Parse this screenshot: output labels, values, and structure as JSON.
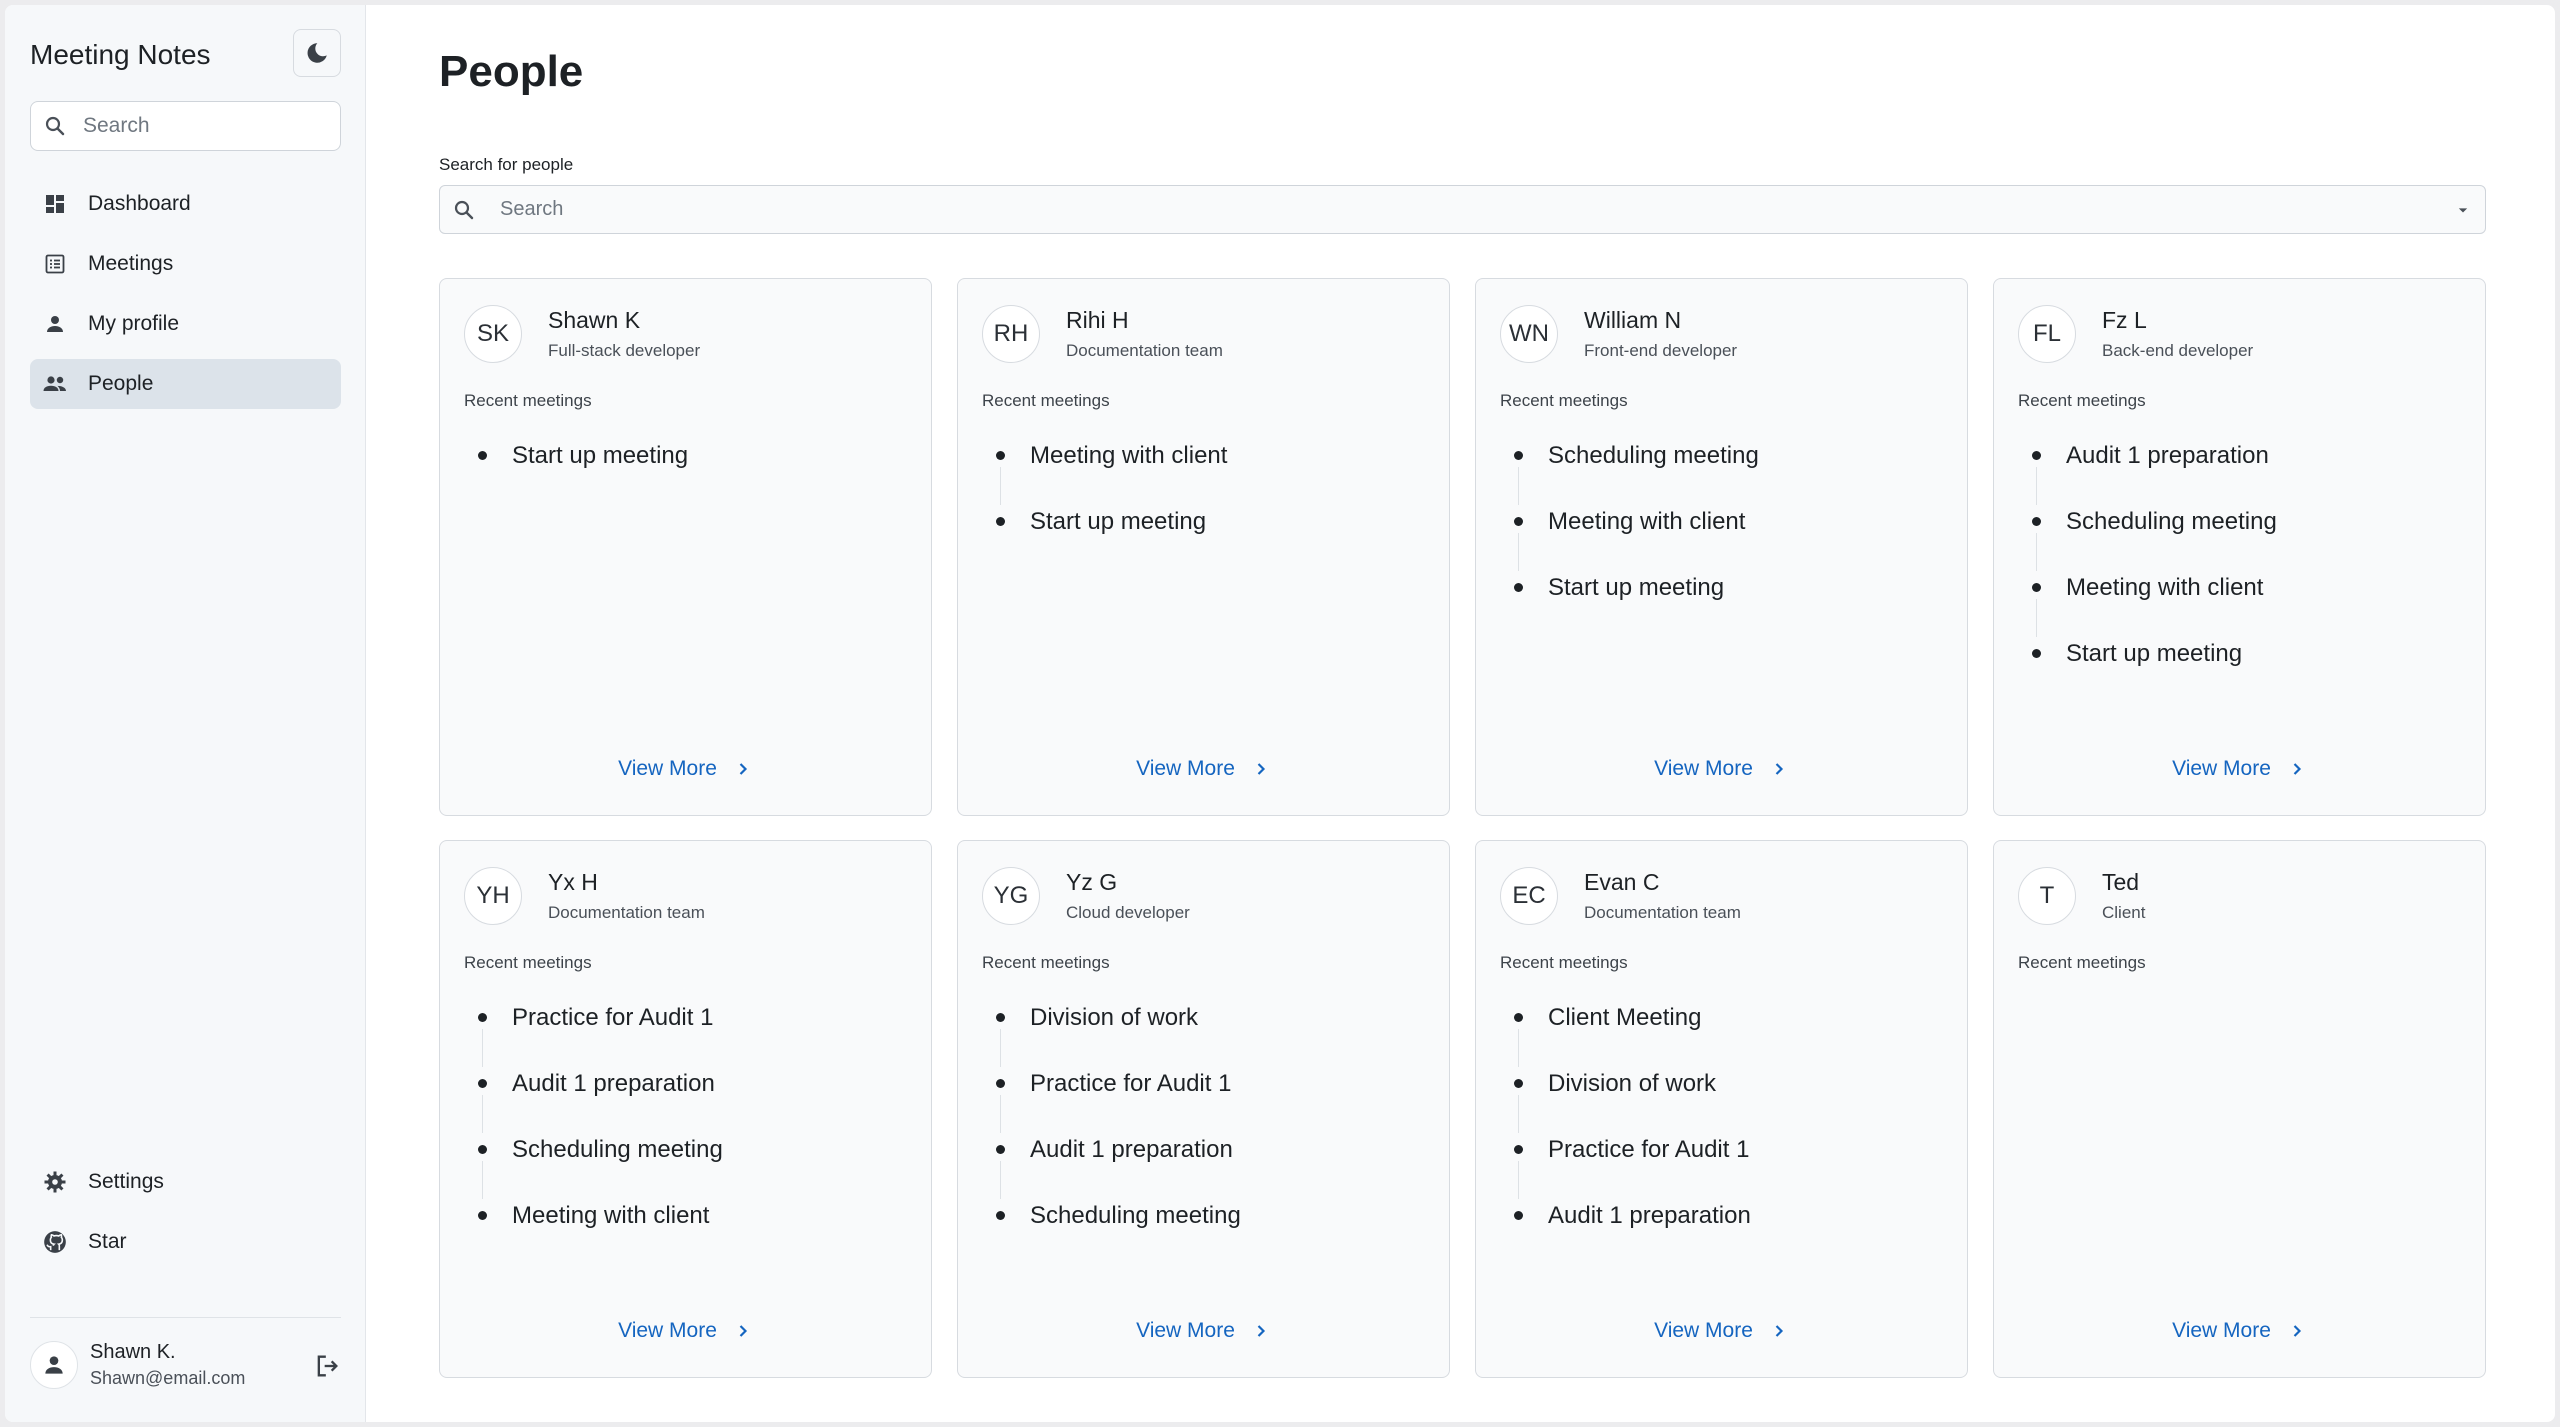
{
  "app": {
    "title": "Meeting Notes"
  },
  "sidebar": {
    "search_placeholder": "Search",
    "nav": [
      {
        "label": "Dashboard",
        "icon": "dashboard-icon",
        "active": false
      },
      {
        "label": "Meetings",
        "icon": "list-icon",
        "active": false
      },
      {
        "label": "My profile",
        "icon": "person-icon",
        "active": false
      },
      {
        "label": "People",
        "icon": "people-icon",
        "active": true
      }
    ],
    "bottom": [
      {
        "label": "Settings",
        "icon": "gear-icon"
      },
      {
        "label": "Star",
        "icon": "github-icon"
      }
    ],
    "user": {
      "name": "Shawn K.",
      "email": "Shawn@email.com"
    }
  },
  "main": {
    "title": "People",
    "search_label": "Search for people",
    "search_placeholder": "Search",
    "recent_label": "Recent meetings",
    "view_more_label": "View More",
    "people": [
      {
        "initials": "SK",
        "name": "Shawn K",
        "role": "Full-stack developer",
        "meetings": [
          "Start up meeting"
        ]
      },
      {
        "initials": "RH",
        "name": "Rihi H",
        "role": "Documentation team",
        "meetings": [
          "Meeting with client",
          "Start up meeting"
        ]
      },
      {
        "initials": "WN",
        "name": "William N",
        "role": "Front-end developer",
        "meetings": [
          "Scheduling meeting",
          "Meeting with client",
          "Start up meeting"
        ]
      },
      {
        "initials": "FL",
        "name": "Fz L",
        "role": "Back-end developer",
        "meetings": [
          "Audit 1 preparation",
          "Scheduling meeting",
          "Meeting with client",
          "Start up meeting"
        ]
      },
      {
        "initials": "YH",
        "name": "Yx H",
        "role": "Documentation team",
        "meetings": [
          "Practice for Audit 1",
          "Audit 1 preparation",
          "Scheduling meeting",
          "Meeting with client"
        ]
      },
      {
        "initials": "YG",
        "name": "Yz G",
        "role": "Cloud developer",
        "meetings": [
          "Division of work",
          "Practice for Audit 1",
          "Audit 1 preparation",
          "Scheduling meeting"
        ]
      },
      {
        "initials": "EC",
        "name": "Evan C",
        "role": "Documentation team",
        "meetings": [
          "Client Meeting",
          "Division of work",
          "Practice for Audit 1",
          "Audit 1 preparation"
        ]
      },
      {
        "initials": "T",
        "name": "Ted",
        "role": "Client",
        "meetings": []
      }
    ]
  },
  "colors": {
    "accent": "#1565c0",
    "active_nav": "#dce3ea",
    "sidebar_bg": "#f6f8fa"
  }
}
